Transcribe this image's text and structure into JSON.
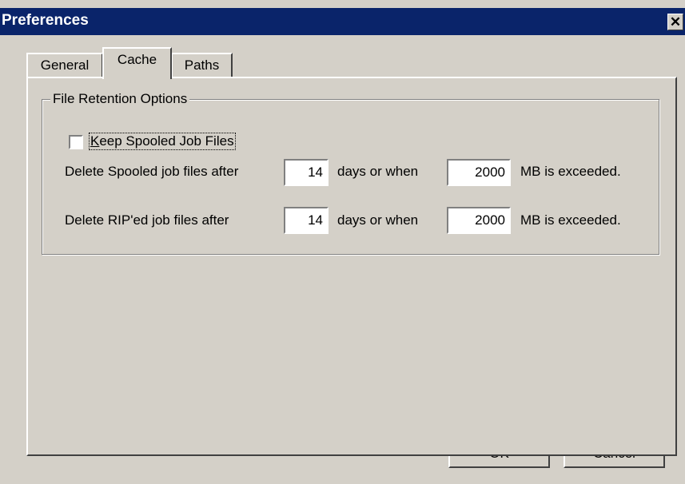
{
  "window": {
    "title": "Preferences",
    "close_glyph": "✕"
  },
  "tabs": [
    {
      "label": "General",
      "selected": false
    },
    {
      "label": "Cache",
      "selected": true
    },
    {
      "label": "Paths",
      "selected": false
    }
  ],
  "retention": {
    "group_label": "File Retention Options",
    "keep_spooled": {
      "label_mnemonic": "K",
      "label_rest": "eep Spooled Job Files",
      "checked": false
    },
    "spooled_row": {
      "label": "Delete Spooled job files after",
      "days": "14",
      "mid_label": "days or when",
      "mb": "2000",
      "tail_label": "MB is exceeded."
    },
    "riped_row": {
      "label": "Delete RIP'ed job files after",
      "days": "14",
      "mid_label": "days or when",
      "mb": "2000",
      "tail_label": "MB is exceeded."
    }
  },
  "buttons": {
    "ok": "OK",
    "cancel": "Cancel"
  }
}
